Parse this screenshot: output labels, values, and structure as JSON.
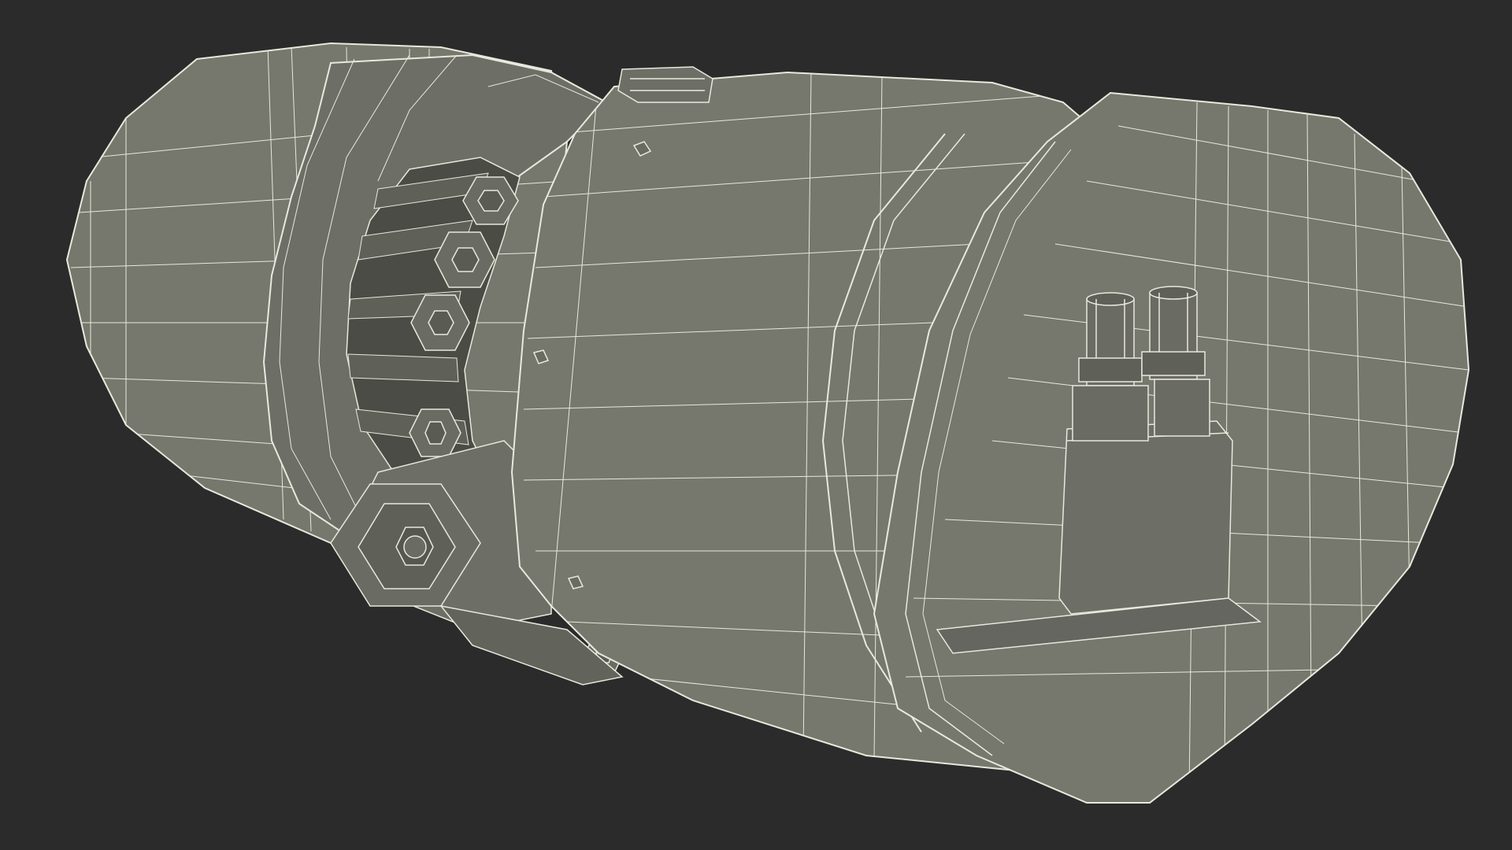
{
  "scene": {
    "subject": "wireframe-motor-render",
    "background_color": "#2b2b2b",
    "surface_color": "#76776d",
    "surface_dark_color": "#5f6058",
    "surface_light_color": "#868779",
    "wire_color": "#e9e8dc",
    "show_wireframe": true
  }
}
